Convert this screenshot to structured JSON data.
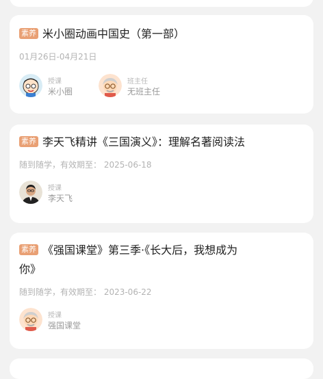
{
  "courses": [
    {
      "badge": "素养",
      "title": "米小圈动画中国史（第一部）",
      "date": "01月26日-04月21日",
      "people": [
        {
          "role": "授课",
          "name": "米小圈",
          "avatar_icon": "cartoon-boy-avatar-icon"
        },
        {
          "role": "班主任",
          "name": "无班主任",
          "avatar_icon": "grandpa-avatar-icon"
        }
      ]
    },
    {
      "badge": "素养",
      "title": "李天飞精讲《三国演义》：理解名著阅读法",
      "date": "随到随学，有效期至： 2025-06-18",
      "people": [
        {
          "role": "授课",
          "name": "李天飞",
          "avatar_icon": "teacher-photo-avatar-icon"
        }
      ]
    },
    {
      "badge": "素养",
      "title_line1": "《强国课堂》第三季·《长大后，我想成为",
      "title_line2": "你》",
      "date": "随到随学，有效期至： 2023-06-22",
      "people": [
        {
          "role": "授课",
          "name": "强国课堂",
          "avatar_icon": "grandpa-avatar-icon"
        }
      ]
    }
  ],
  "colors": {
    "badge": "#e9a074",
    "background": "#f2f2f2",
    "card": "#ffffff"
  }
}
